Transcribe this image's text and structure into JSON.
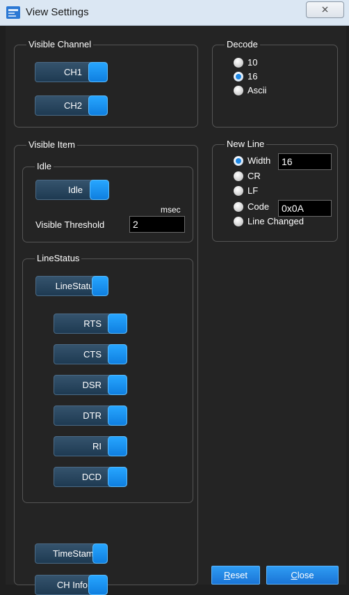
{
  "window": {
    "title": "View Settings",
    "close_glyph": "⨯"
  },
  "visible_channel": {
    "legend": "Visible Channel",
    "buttons": [
      {
        "label": "CH1",
        "on": true
      },
      {
        "label": "CH2",
        "on": true
      }
    ]
  },
  "decode": {
    "legend": "Decode",
    "options": [
      {
        "label": "10",
        "selected": false
      },
      {
        "label": "16",
        "selected": true
      },
      {
        "label": "Ascii",
        "selected": false
      }
    ]
  },
  "visible_item": {
    "legend": "Visible Item",
    "idle": {
      "legend": "Idle",
      "toggle_label": "Idle",
      "threshold_label": "Visible Threshold",
      "threshold_value": "2",
      "unit": "msec"
    },
    "line_status": {
      "legend": "LineStatus",
      "master_label": "LineStatus",
      "signals": [
        {
          "label": "RTS"
        },
        {
          "label": "CTS"
        },
        {
          "label": "DSR"
        },
        {
          "label": "DTR"
        },
        {
          "label": "RI"
        },
        {
          "label": "DCD"
        }
      ]
    },
    "timestamp_label": "TimeStamp",
    "ch_info_label": "CH Info"
  },
  "new_line": {
    "legend": "New Line",
    "options": [
      {
        "label": "Width",
        "selected": true
      },
      {
        "label": "CR",
        "selected": false
      },
      {
        "label": "LF",
        "selected": false
      },
      {
        "label": "Code",
        "selected": false
      },
      {
        "label": "Line Changed",
        "selected": false
      }
    ],
    "width_value": "16",
    "code_value": "0x0A"
  },
  "footer": {
    "reset_accel": "R",
    "reset_rest": "eset",
    "close_accel": "C",
    "close_rest": "lose"
  },
  "colors": {
    "accent": "#1e88e5",
    "background": "#242424",
    "title_bar": "#dbe7f3"
  },
  "icons": [
    "app-window-icon",
    "close-icon"
  ]
}
